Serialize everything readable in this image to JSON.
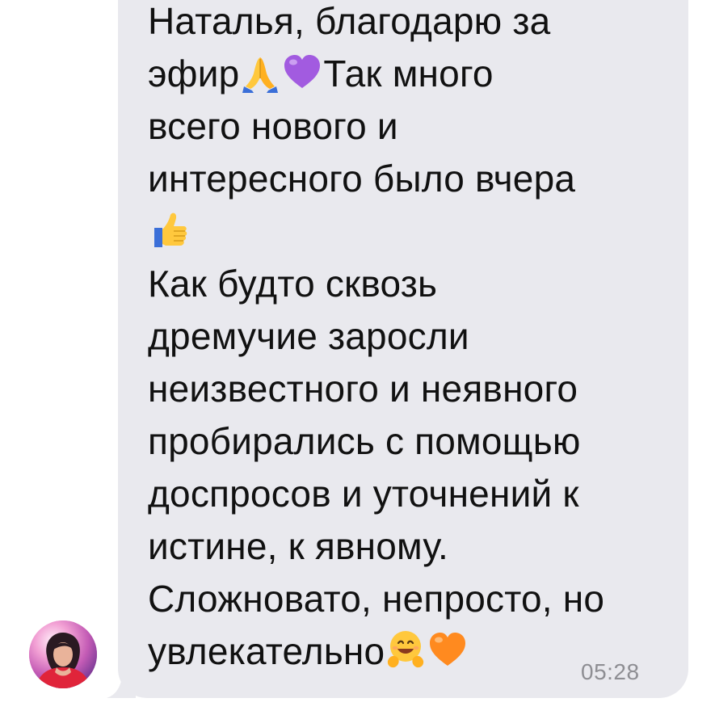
{
  "message": {
    "lines": [
      {
        "text": "Наталья, благодарю за"
      },
      {
        "text": "эфир",
        "emoji_after": [
          "folded-hands-icon",
          "purple-heart-icon"
        ],
        "text_after": "Так много"
      },
      {
        "text": "всего нового и"
      },
      {
        "text": "интересного было вчера"
      },
      {
        "text": "",
        "emoji_after": [
          "thumbs-up-icon"
        ]
      },
      {
        "text": "Как будто сквозь"
      },
      {
        "text": "дремучие заросли"
      },
      {
        "text": "неизвестного и неявного"
      },
      {
        "text": "пробирались с помощью"
      },
      {
        "text": "доспросов и уточнений к"
      },
      {
        "text": "истине, к явному."
      },
      {
        "text": "Сложновато, непросто, но"
      },
      {
        "text": "увлекательно",
        "emoji_after": [
          "hugging-face-icon",
          "orange-heart-icon"
        ]
      }
    ],
    "timestamp": "05:28"
  },
  "colors": {
    "bubble": "#e9e9ee",
    "text": "#111111",
    "timestamp": "#8e8e93"
  }
}
